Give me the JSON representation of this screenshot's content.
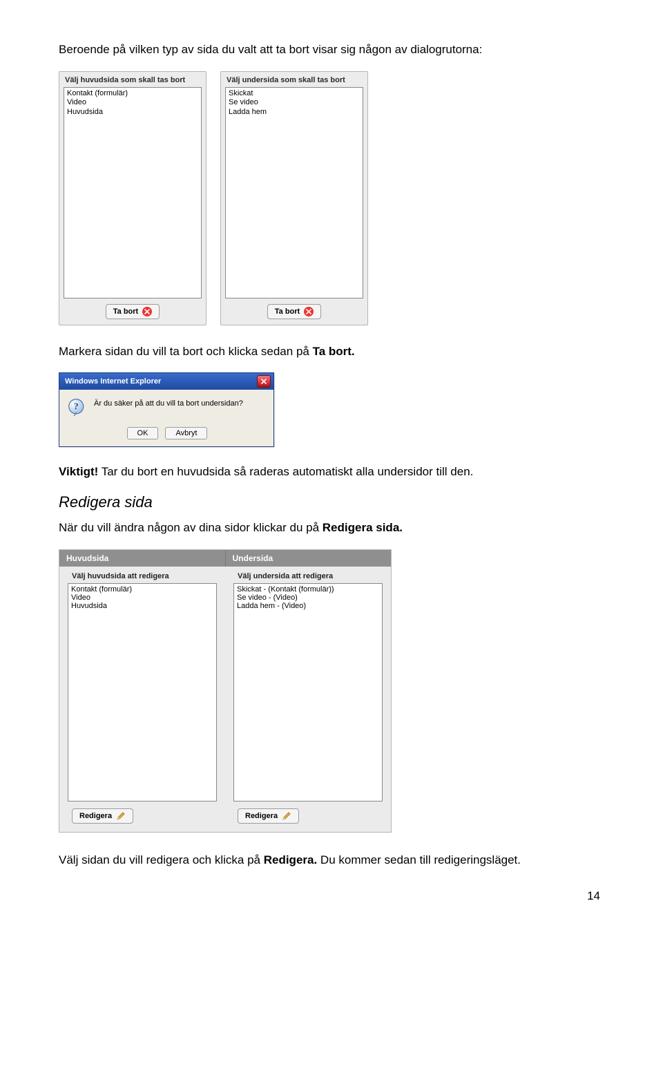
{
  "intro": "Beroende på vilken typ av sida du valt att ta bort visar sig någon av dialogrutorna:",
  "dialogs": {
    "left": {
      "title": "Välj huvudsida som skall tas bort",
      "items": [
        "Kontakt (formulär)",
        "Video",
        "Huvudsida"
      ],
      "button": "Ta bort"
    },
    "right": {
      "title": "Välj undersida som skall tas bort",
      "items": [
        "Skickat",
        "Se video",
        "Ladda hem"
      ],
      "button": "Ta bort"
    }
  },
  "mark_text_pre": "Markera sidan du vill ta bort och klicka sedan på ",
  "mark_text_bold": "Ta bort.",
  "ie": {
    "title": "Windows Internet Explorer",
    "message": "Är du säker på att du vill ta bort undersidan?",
    "ok": "OK",
    "cancel": "Avbryt"
  },
  "important_label": "Viktigt!",
  "important_rest": " Tar du bort en huvudsida så raderas automatiskt alla undersidor till den.",
  "heading": "Redigera sida",
  "edit_intro_pre": "När du vill ändra någon av dina sidor klickar du på ",
  "edit_intro_bold": "Redigera sida.",
  "edit_panel": {
    "left": {
      "header": "Huvudsida",
      "sub": "Välj huvudsida att redigera",
      "items": [
        "Kontakt (formulär)",
        "Video",
        "Huvudsida"
      ],
      "button": "Redigera"
    },
    "right": {
      "header": "Undersida",
      "sub": "Välj undersida att redigera",
      "items": [
        "Skickat - (Kontakt (formulär))",
        "Se video - (Video)",
        "Ladda hem - (Video)"
      ],
      "button": "Redigera"
    }
  },
  "outro_pre": "Välj sidan du vill redigera och klicka på ",
  "outro_bold": "Redigera.",
  "outro_post": " Du kommer sedan till redigeringsläget.",
  "page_number": "14"
}
